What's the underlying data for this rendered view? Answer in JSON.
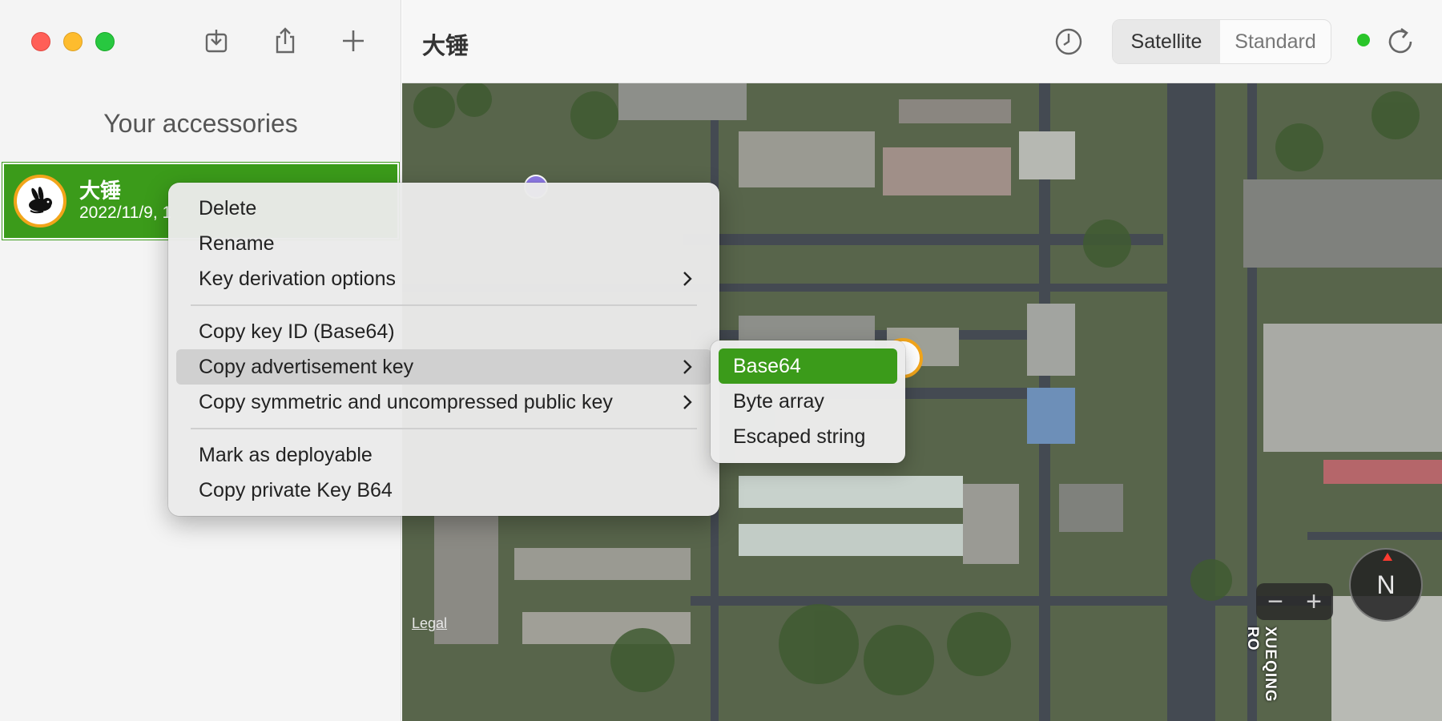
{
  "window": {
    "title": "大锤",
    "traffic_lights": [
      "close",
      "minimize",
      "maximize"
    ]
  },
  "sidebar": {
    "heading": "Your accessories",
    "toolbar_icons": [
      "import-icon",
      "share-icon",
      "plus-icon"
    ],
    "accessories": [
      {
        "name": "大锤",
        "date": "2022/11/9, 1",
        "icon": "rabbit-icon",
        "selected": true,
        "accent": "#3b9b1a",
        "ring": "#f2a51a"
      }
    ]
  },
  "toolbar": {
    "history_icon": "clock-icon",
    "map_modes": [
      "Satellite",
      "Standard"
    ],
    "selected_mode": "Satellite",
    "status": "online",
    "status_color": "#2ac52a",
    "refresh_icon": "refresh-icon"
  },
  "map": {
    "legal": "Legal",
    "zoom_out": "−",
    "zoom_in": "+",
    "compass": "N",
    "street_label": "XUEQING RO"
  },
  "context_menu": {
    "items": [
      {
        "label": "Delete"
      },
      {
        "label": "Rename"
      },
      {
        "label": "Key derivation options",
        "submenu": true
      },
      {
        "label": "Copy key ID (Base64)"
      },
      {
        "label": "Copy advertisement key",
        "submenu": true,
        "highlighted": true
      },
      {
        "label": "Copy symmetric and uncompressed public key",
        "submenu": true
      },
      {
        "label": "Mark as deployable"
      },
      {
        "label": "Copy private Key B64"
      }
    ]
  },
  "submenu": {
    "items": [
      {
        "label": "Base64",
        "selected": true
      },
      {
        "label": "Byte array"
      },
      {
        "label": "Escaped string"
      }
    ]
  }
}
